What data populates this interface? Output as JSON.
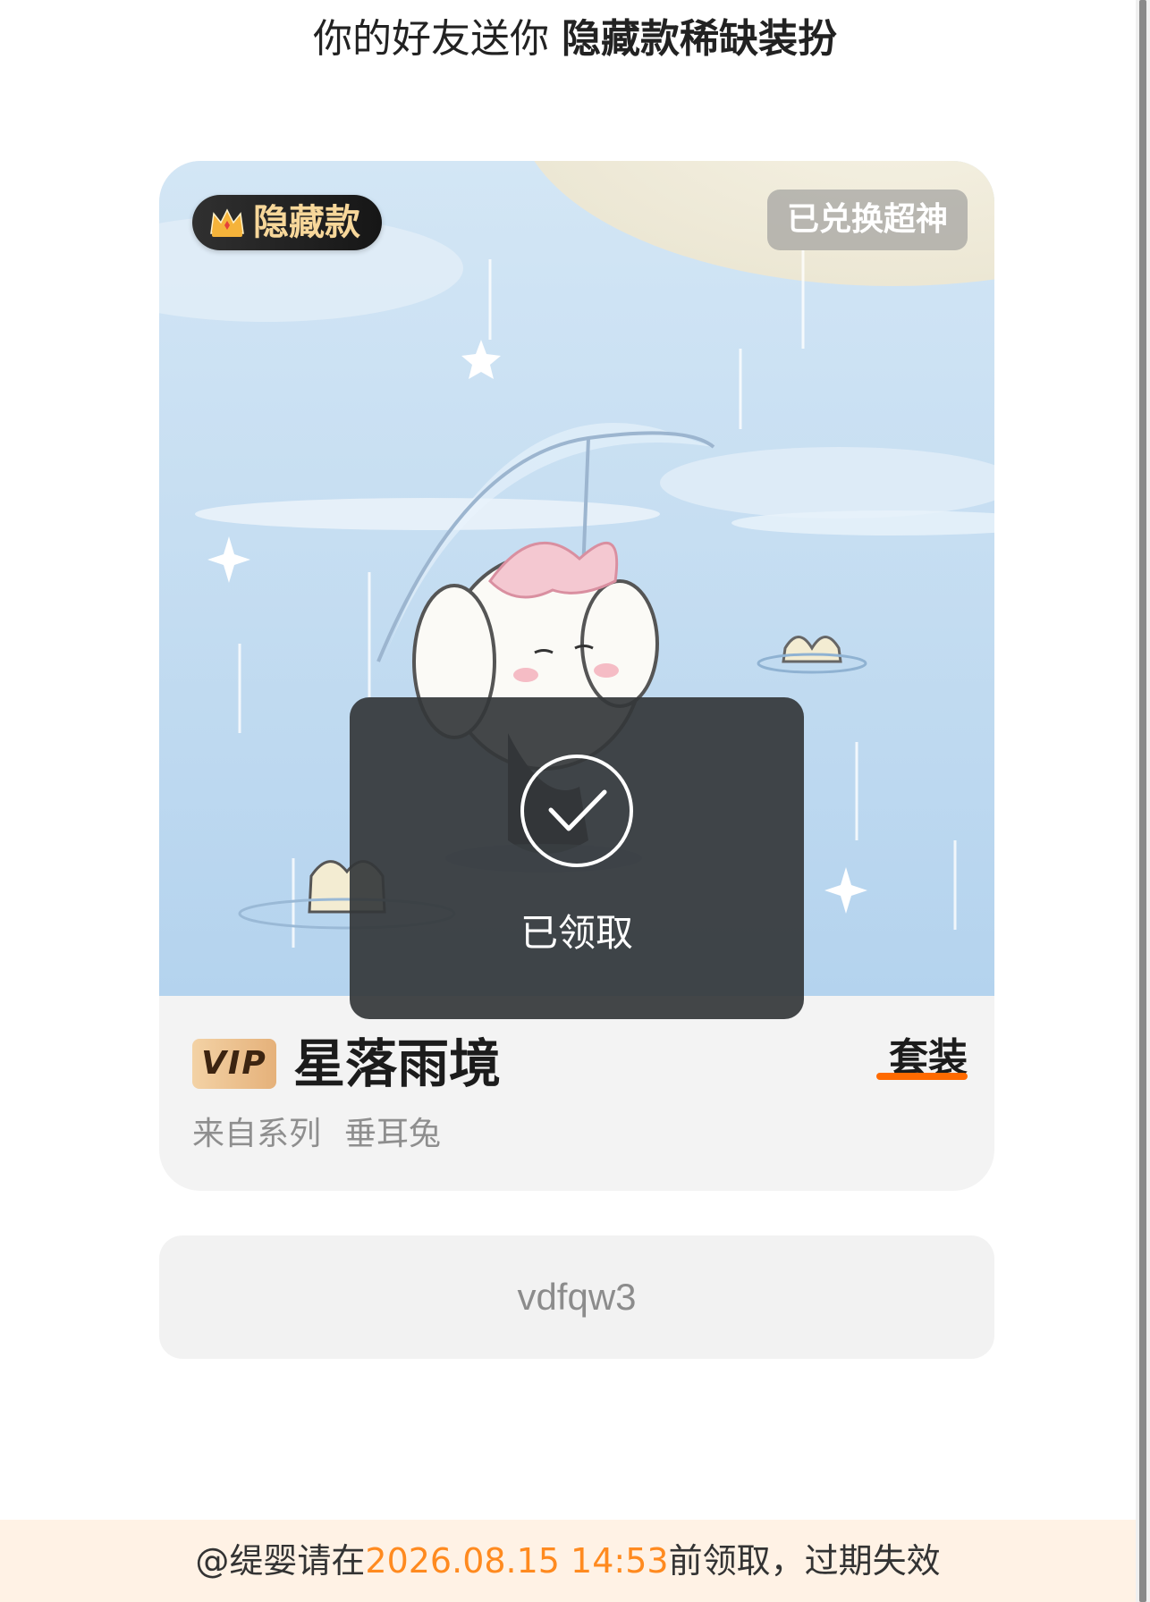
{
  "header": {
    "prefix": "你的好友送你",
    "highlight": "隐藏款稀缺装扮"
  },
  "card": {
    "hidden_badge": {
      "label": "隐藏款",
      "icon": "crown-icon"
    },
    "exchanged_badge": "已兑换超神",
    "vip_badge": "VIP",
    "title": "星落雨境",
    "type_tag": "套装",
    "series_label": "来自系列",
    "series_name": "垂耳兔"
  },
  "code": "vdfqw3",
  "footer": {
    "prefix": "@缇婴请在",
    "deadline": "2026.08.15 14:53",
    "suffix": "前领取，过期失效"
  },
  "toast": {
    "icon": "check-circle-icon",
    "message": "已领取"
  },
  "colors": {
    "accent_orange": "#ff8a1f",
    "underline_orange": "#ff6a00",
    "toast_bg": "#34373a",
    "footer_bg": "#fff2e5",
    "badge_gold": "#f7d79a",
    "sky_blue": "#c6ddf0"
  }
}
